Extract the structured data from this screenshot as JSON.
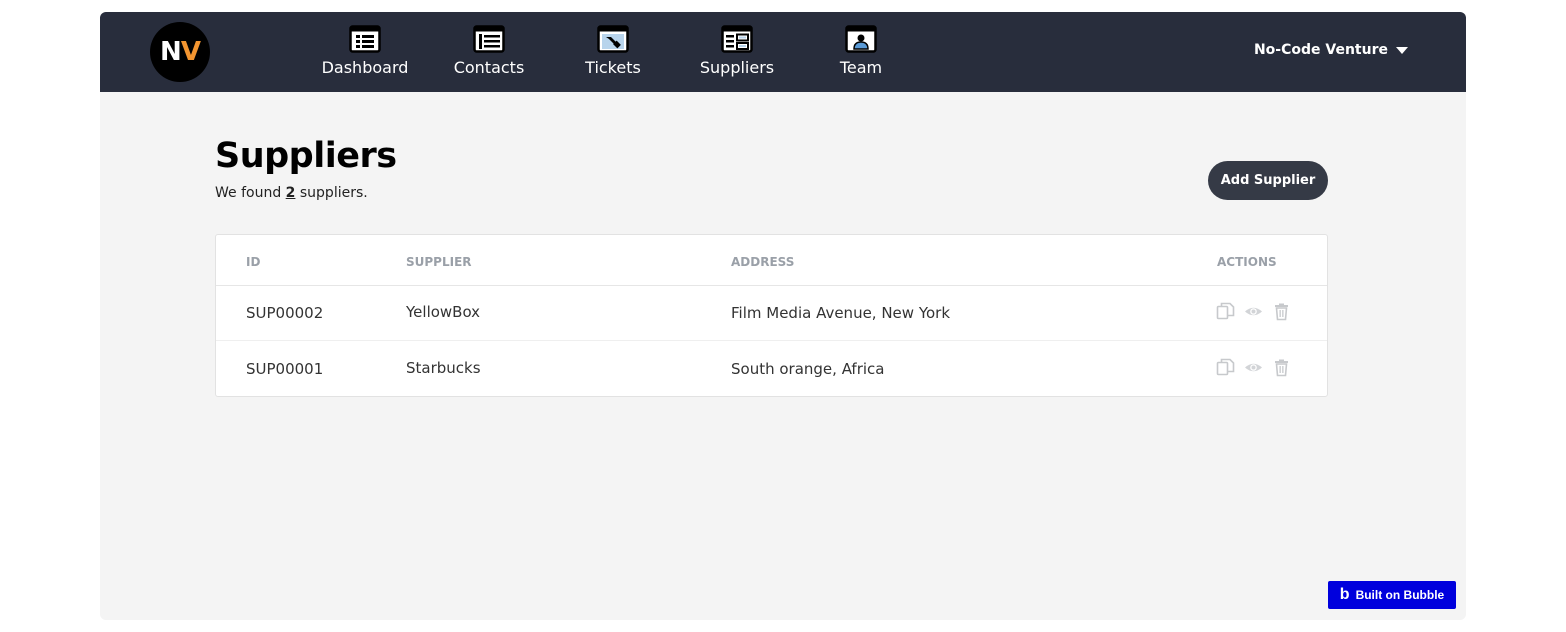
{
  "brand": {
    "logo_n": "N",
    "logo_v": "V"
  },
  "nav": {
    "items": [
      {
        "label": "Dashboard",
        "icon": "dashboard-icon"
      },
      {
        "label": "Contacts",
        "icon": "contacts-icon"
      },
      {
        "label": "Tickets",
        "icon": "tickets-icon"
      },
      {
        "label": "Suppliers",
        "icon": "suppliers-icon"
      },
      {
        "label": "Team",
        "icon": "team-icon"
      }
    ],
    "account_name": "No-Code Venture"
  },
  "page": {
    "title": "Suppliers",
    "found_prefix": "We found ",
    "found_count": "2",
    "found_suffix": " suppliers.",
    "add_button": "Add Supplier"
  },
  "table": {
    "headers": [
      "ID",
      "SUPPLIER",
      "ADDRESS",
      "ACTIONS"
    ],
    "rows": [
      {
        "id": "SUP00002",
        "supplier": "YellowBox",
        "address": "Film Media Avenue, New York"
      },
      {
        "id": "SUP00001",
        "supplier": "Starbucks",
        "address": "South orange, Africa"
      }
    ],
    "action_icons": [
      "copy-icon",
      "view-icon",
      "delete-icon"
    ]
  },
  "badge": {
    "logo": "b",
    "label": "Built on Bubble"
  },
  "colors": {
    "navbar": "#282d3c",
    "accent_orange": "#f39530",
    "button": "#353a46",
    "bubble_blue": "#0000dd",
    "background": "#f4f4f4"
  }
}
